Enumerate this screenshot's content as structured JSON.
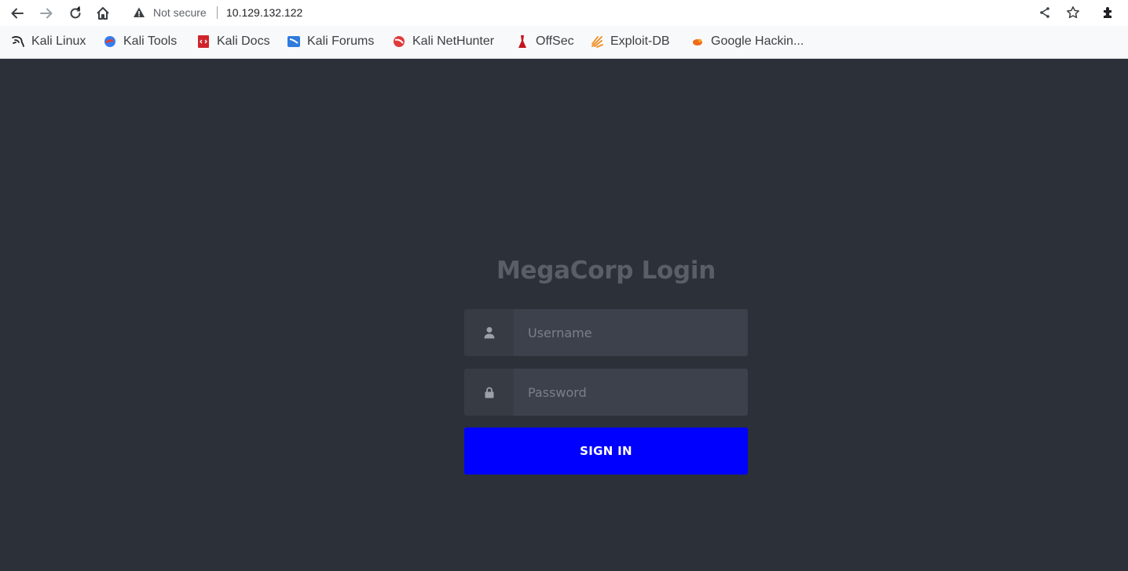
{
  "browser": {
    "security_status": "Not secure",
    "url": "10.129.132.122",
    "nav_icons": [
      "back-arrow-icon",
      "forward-arrow-icon",
      "reload-icon",
      "home-icon"
    ],
    "right_icons": [
      "share-icon",
      "star-icon",
      "extensions-icon"
    ]
  },
  "bookmarks": [
    {
      "label": "Kali Linux",
      "icon": "kali-dragon-icon"
    },
    {
      "label": "Kali Tools",
      "icon": "kali-tools-icon"
    },
    {
      "label": "Kali Docs",
      "icon": "kali-docs-icon"
    },
    {
      "label": "Kali Forums",
      "icon": "kali-forums-icon"
    },
    {
      "label": "Kali NetHunter",
      "icon": "kali-nethunter-icon"
    },
    {
      "label": "OffSec",
      "icon": "offsec-icon"
    },
    {
      "label": "Exploit-DB",
      "icon": "exploit-db-icon"
    },
    {
      "label": "Google Hackin...",
      "icon": "ghdb-icon"
    }
  ],
  "login": {
    "title": "MegaCorp Login",
    "username_placeholder": "Username",
    "password_placeholder": "Password",
    "signin_label": "SIGN IN"
  },
  "colors": {
    "page_background": "#2b3039",
    "signin_button": "#0000ff",
    "title_text": "#5a5e66",
    "input_background": "#3c414b",
    "icon_background": "#363b44"
  }
}
